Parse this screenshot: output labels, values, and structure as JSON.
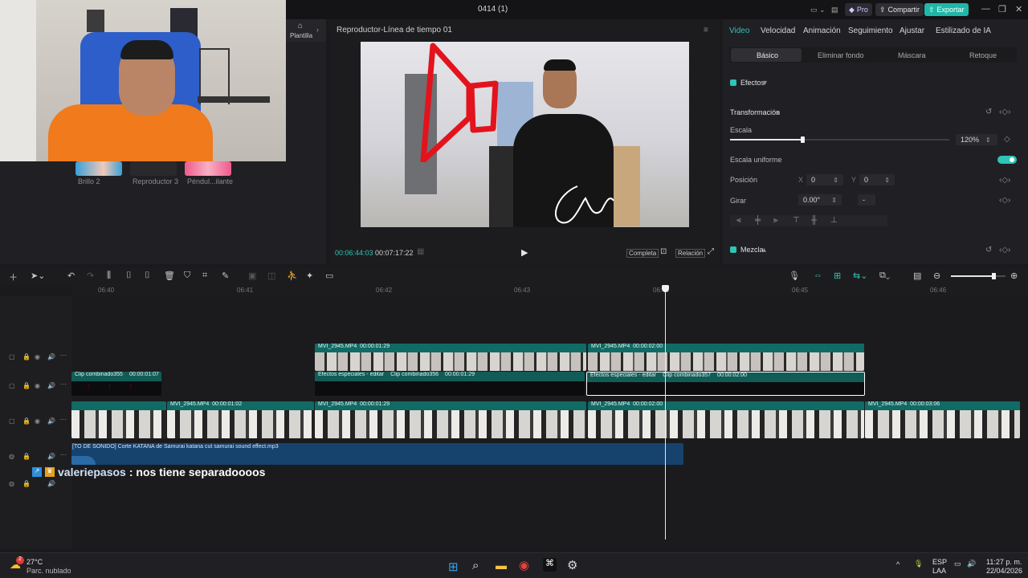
{
  "window": {
    "title": "0414 (1)",
    "pro_label": "Pro",
    "share_label": "Compartir",
    "export_label": "Exportar"
  },
  "left_panel": {
    "templates_tab_label": "Plantilla",
    "thumbnails": [
      {
        "label": "Brillo 2"
      },
      {
        "label": "Reproductor 3"
      },
      {
        "label": "Péndul...ilante"
      }
    ]
  },
  "player": {
    "title": "Reproductor-Línea de tiempo 01",
    "current_time": "00:06:44:03",
    "total_time": "00:07:17:22",
    "full_label": "Completa",
    "ratio_label": "Relación"
  },
  "inspector": {
    "tabs": [
      "Video",
      "Velocidad",
      "Animación",
      "Seguimiento",
      "Ajustar",
      "Estilizado de IA"
    ],
    "active_tab": "Video",
    "subtabs": [
      "Básico",
      "Eliminar fondo",
      "Máscara",
      "Retoque"
    ],
    "active_subtab": "Básico",
    "effects_label": "Efectos",
    "transform_label": "Transformación",
    "scale_label": "Escala",
    "scale_value": "120%",
    "scale_fraction": 0.33,
    "uniform_scale_label": "Escala uniforme",
    "position_label": "Posición",
    "pos_x_label": "X",
    "pos_x_value": "0",
    "pos_y_label": "Y",
    "pos_y_value": "0",
    "rotate_label": "Girar",
    "rotate_value": "0.00°",
    "rotate_dash": "-",
    "blend_label": "Mezcla"
  },
  "timeline": {
    "zoom_fraction": 0.78,
    "ruler_ticks": [
      "06:40",
      "06:41",
      "06:42",
      "06:43",
      "06:44",
      "06:45",
      "06:46"
    ],
    "track1_clips": [
      {
        "label": "MVI_2945.MP4",
        "duration": "00:00:01:29"
      },
      {
        "label": "MVI_2945.MP4",
        "duration": "00:00:02:00"
      }
    ],
    "track2_clips": [
      {
        "label": "Clip combinado355",
        "duration": "00:00:01:07"
      },
      {
        "fx": "Efectos especiales - editar",
        "label": "Clip combinado356",
        "duration": "00:00:01:29"
      },
      {
        "fx": "Efectos especiales - editar",
        "label": "Clip combinado357",
        "duration": "00:00:02:00"
      }
    ],
    "main_clips": [
      {
        "label": "MVI_2945.MP4",
        "duration": "00:00:01:02"
      },
      {
        "label": "MVI_2945.MP4",
        "duration": "00:00:01:29"
      },
      {
        "label": "MVI_2945.MP4",
        "duration": "00:00:02:00"
      },
      {
        "label": "MVI_2945.MP4",
        "duration": "00:00:03:06"
      }
    ],
    "audio_clip": "[TO DE SONIDO] Corte KATANA de Samurai  katana cut samurai sound effect.mp3"
  },
  "chat_overlay": {
    "username": "valeriepasos",
    "message": ": nos tiene separadoooos"
  },
  "taskbar": {
    "weather_temp": "27°C",
    "weather_desc": "Parc. nublado",
    "notification_count": "2",
    "lang_top": "ESP",
    "lang_bottom": "LAA",
    "time": "11:27 p. m.",
    "date": "22/04/2026"
  },
  "colors": {
    "accent": "#2ec4b6",
    "clip_teal": "#0f6b64",
    "audio_blue": "#16426e",
    "export_btn": "#1fb8a8"
  }
}
